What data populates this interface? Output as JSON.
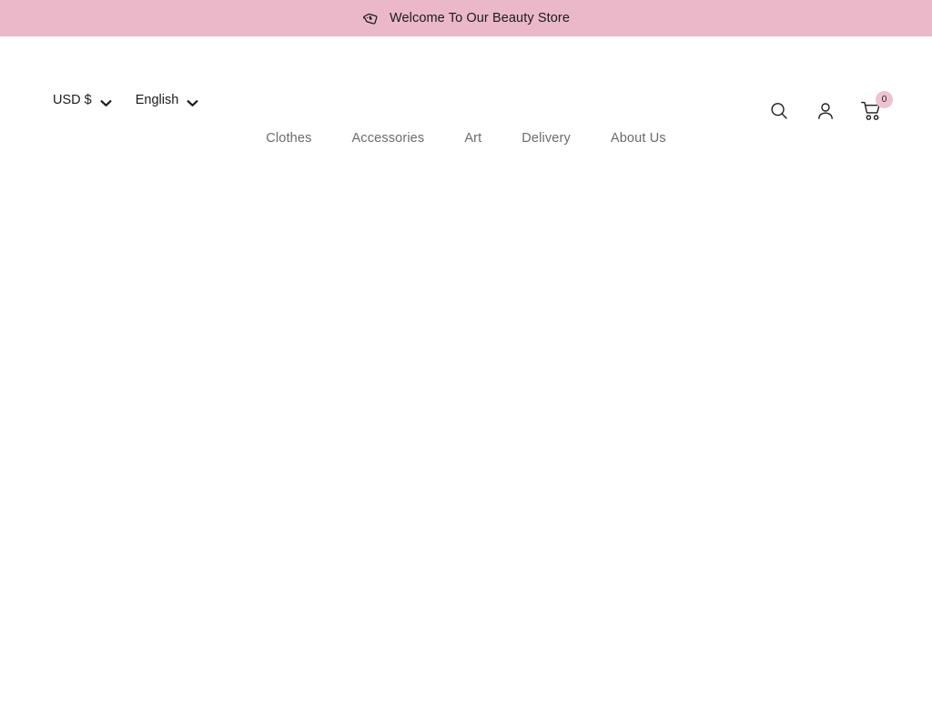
{
  "announcement": {
    "icon": "price-tag-icon",
    "text": "Welcome To Our Beauty Store",
    "background_color": "#eab8c9",
    "text_color": "#1c1c1c"
  },
  "header": {
    "currency_selector": {
      "value": "USD $",
      "icon": "chevron-down-icon"
    },
    "language_selector": {
      "value": "English",
      "icon": "chevron-down-icon"
    },
    "actions": [
      {
        "name": "search-icon",
        "label": "Search"
      },
      {
        "name": "account-icon",
        "label": "Account"
      },
      {
        "name": "cart-icon",
        "label": "Cart"
      }
    ],
    "cart": {
      "count": "0",
      "badge_color": "#eec2d1"
    }
  },
  "nav": {
    "items": [
      {
        "label": "Clothes"
      },
      {
        "label": "Accessories"
      },
      {
        "label": "Art"
      },
      {
        "label": "Delivery"
      },
      {
        "label": "About Us"
      }
    ],
    "text_color": "#6b6b6b"
  }
}
